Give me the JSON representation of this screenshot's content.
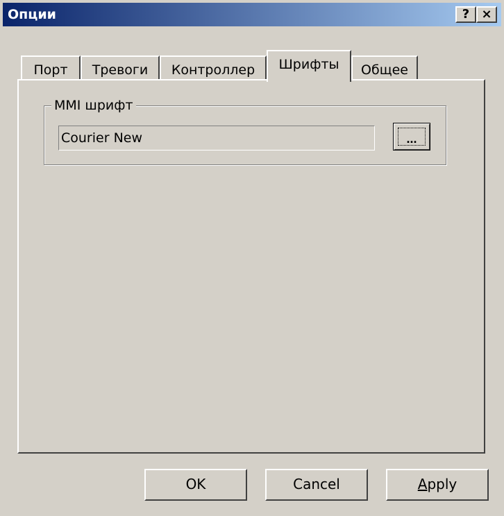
{
  "window": {
    "title": "Опции",
    "help_symbol": "?",
    "close_symbol": "×"
  },
  "tabs": [
    {
      "label": "Порт"
    },
    {
      "label": "Тревоги"
    },
    {
      "label": "Контроллер"
    },
    {
      "label": "Шрифты",
      "active": true
    },
    {
      "label": "Общее"
    }
  ],
  "fonts_tab": {
    "group_label": "MMI шрифт",
    "font_value": "Courier New",
    "browse_label": "..."
  },
  "buttons": {
    "ok": "OK",
    "cancel": "Cancel",
    "apply": "Apply"
  },
  "icons": {
    "help": "help-icon",
    "close": "close-icon"
  }
}
